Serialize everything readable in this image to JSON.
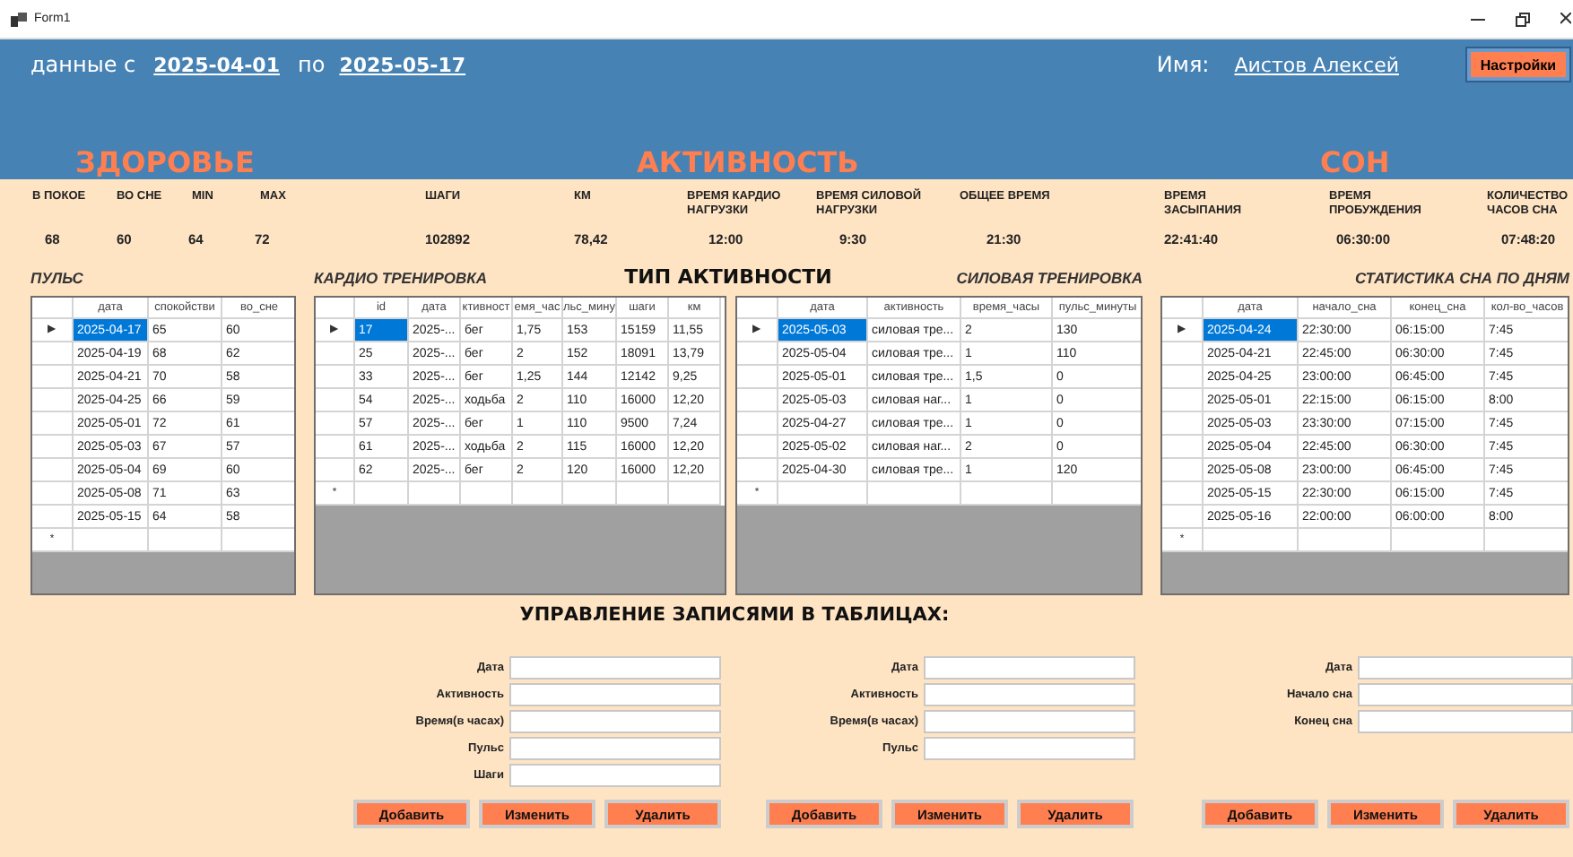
{
  "window": {
    "title": "Form1"
  },
  "header": {
    "period_label": "данные с",
    "date_from": "2025-04-01",
    "to_label": "по",
    "date_to": "2025-05-17",
    "name_label": "Имя:",
    "user_name": "Аистов Алексей",
    "settings_button": "Настройки",
    "sections": [
      "ЗДОРОВЬЕ",
      "АКТИВНОСТЬ",
      "СОН"
    ]
  },
  "stats": [
    {
      "label": "В ПОКОЕ",
      "value": "68"
    },
    {
      "label": "ВО СНЕ",
      "value": "60"
    },
    {
      "label": "MIN",
      "value": "64"
    },
    {
      "label": "MAX",
      "value": "72"
    },
    {
      "label": "ШАГИ",
      "value": "102892"
    },
    {
      "label": "КМ",
      "value": "78,42"
    },
    {
      "label": "ВРЕМЯ КАРДИО НАГРУЗКИ",
      "value": "12:00"
    },
    {
      "label": "ВРЕМЯ СИЛОВОЙ НАГРУЗКИ",
      "value": "9:30"
    },
    {
      "label": "ОБЩЕЕ ВРЕМЯ",
      "value": "21:30"
    },
    {
      "label": "ВРЕМЯ ЗАСЫПАНИЯ",
      "value": "22:41:40"
    },
    {
      "label": "ВРЕМЯ ПРОБУЖДЕНИЯ",
      "value": "06:30:00"
    },
    {
      "label": "КОЛИЧЕСТВО ЧАСОВ СНА",
      "value": "07:48:20"
    }
  ],
  "activity_heading": "ТИП АКТИВНОСТИ",
  "tables": [
    {
      "title": "ПУЛЬС",
      "row_marker": "▶",
      "new_row_marker": "*",
      "columns": [
        "дата",
        "спокойстви",
        "во_сне"
      ],
      "rows": [
        {
          "cells": [
            "2025-04-17",
            "65",
            "60"
          ],
          "selected": true
        },
        {
          "cells": [
            "2025-04-19",
            "68",
            "62"
          ],
          "selected": false
        },
        {
          "cells": [
            "2025-04-21",
            "70",
            "58"
          ],
          "selected": false
        },
        {
          "cells": [
            "2025-04-25",
            "66",
            "59"
          ],
          "selected": false
        },
        {
          "cells": [
            "2025-05-01",
            "72",
            "61"
          ],
          "selected": false
        },
        {
          "cells": [
            "2025-05-03",
            "67",
            "57"
          ],
          "selected": false
        },
        {
          "cells": [
            "2025-05-04",
            "69",
            "60"
          ],
          "selected": false
        },
        {
          "cells": [
            "2025-05-08",
            "71",
            "63"
          ],
          "selected": false
        },
        {
          "cells": [
            "2025-05-15",
            "64",
            "58"
          ],
          "selected": false
        }
      ]
    },
    {
      "title": "КАРДИО ТРЕНИРОВКА",
      "row_marker": "▶",
      "new_row_marker": "*",
      "columns": [
        "id",
        "дата",
        "ктивност",
        "емя_час",
        "льс_мину",
        "шаги",
        "км"
      ],
      "rows": [
        {
          "cells": [
            "17",
            "2025-...",
            "бег",
            "1,75",
            "153",
            "15159",
            "11,55"
          ],
          "selected": true
        },
        {
          "cells": [
            "25",
            "2025-...",
            "бег",
            "2",
            "152",
            "18091",
            "13,79"
          ],
          "selected": false
        },
        {
          "cells": [
            "33",
            "2025-...",
            "бег",
            "1,25",
            "144",
            "12142",
            "9,25"
          ],
          "selected": false
        },
        {
          "cells": [
            "54",
            "2025-...",
            "ходьба",
            "2",
            "110",
            "16000",
            "12,20"
          ],
          "selected": false
        },
        {
          "cells": [
            "57",
            "2025-...",
            "бег",
            "1",
            "110",
            "9500",
            "7,24"
          ],
          "selected": false
        },
        {
          "cells": [
            "61",
            "2025-...",
            "ходьба",
            "2",
            "115",
            "16000",
            "12,20"
          ],
          "selected": false
        },
        {
          "cells": [
            "62",
            "2025-...",
            "бег",
            "2",
            "120",
            "16000",
            "12,20"
          ],
          "selected": false
        }
      ]
    },
    {
      "title": "СИЛОВАЯ ТРЕНИРОВКА",
      "row_marker": "▶",
      "new_row_marker": "*",
      "columns": [
        "дата",
        "активность",
        "время_часы",
        "пульс_минуты"
      ],
      "rows": [
        {
          "cells": [
            "2025-05-03",
            "силовая тре...",
            "2",
            "130"
          ],
          "selected": true
        },
        {
          "cells": [
            "2025-05-04",
            "силовая тре...",
            "1",
            "110"
          ],
          "selected": false
        },
        {
          "cells": [
            "2025-05-01",
            "силовая тре...",
            "1,5",
            "0"
          ],
          "selected": false
        },
        {
          "cells": [
            "2025-05-03",
            "силовая наг...",
            "1",
            "0"
          ],
          "selected": false
        },
        {
          "cells": [
            "2025-04-27",
            "силовая тре...",
            "1",
            "0"
          ],
          "selected": false
        },
        {
          "cells": [
            "2025-05-02",
            "силовая наг...",
            "2",
            "0"
          ],
          "selected": false
        },
        {
          "cells": [
            "2025-04-30",
            "силовая тре...",
            "1",
            "120"
          ],
          "selected": false
        }
      ]
    },
    {
      "title": "СТАТИСТИКА СНА ПО ДНЯМ",
      "row_marker": "▶",
      "new_row_marker": "*",
      "columns": [
        "дата",
        "начало_сна",
        "конец_сна",
        "кол-во_часов"
      ],
      "rows": [
        {
          "cells": [
            "2025-04-24",
            "22:30:00",
            "06:15:00",
            "7:45"
          ],
          "selected": true
        },
        {
          "cells": [
            "2025-04-21",
            "22:45:00",
            "06:30:00",
            "7:45"
          ],
          "selected": false
        },
        {
          "cells": [
            "2025-04-25",
            "23:00:00",
            "06:45:00",
            "7:45"
          ],
          "selected": false
        },
        {
          "cells": [
            "2025-05-01",
            "22:15:00",
            "06:15:00",
            "8:00"
          ],
          "selected": false
        },
        {
          "cells": [
            "2025-05-03",
            "23:30:00",
            "07:15:00",
            "7:45"
          ],
          "selected": false
        },
        {
          "cells": [
            "2025-05-04",
            "22:45:00",
            "06:30:00",
            "7:45"
          ],
          "selected": false
        },
        {
          "cells": [
            "2025-05-08",
            "23:00:00",
            "06:45:00",
            "7:45"
          ],
          "selected": false
        },
        {
          "cells": [
            "2025-05-15",
            "22:30:00",
            "06:15:00",
            "7:45"
          ],
          "selected": false
        },
        {
          "cells": [
            "2025-05-16",
            "22:00:00",
            "06:00:00",
            "8:00"
          ],
          "selected": false
        }
      ]
    }
  ],
  "management": {
    "title": "УПРАВЛЕНИЕ ЗАПИСЯМИ В ТАБЛИЦАХ:",
    "forms": [
      {
        "fields": [
          "Дата",
          "Активность",
          "Время(в часах)",
          "Пульс",
          "Шаги"
        ],
        "buttons": [
          "Добавить",
          "Изменить",
          "Удалить"
        ]
      },
      {
        "fields": [
          "Дата",
          "Активность",
          "Время(в часах)",
          "Пульс"
        ],
        "buttons": [
          "Добавить",
          "Изменить",
          "Удалить"
        ]
      },
      {
        "fields": [
          "Дата",
          "Начало сна",
          "Конец сна"
        ],
        "buttons": [
          "Добавить",
          "Изменить",
          "Удалить"
        ]
      }
    ]
  }
}
